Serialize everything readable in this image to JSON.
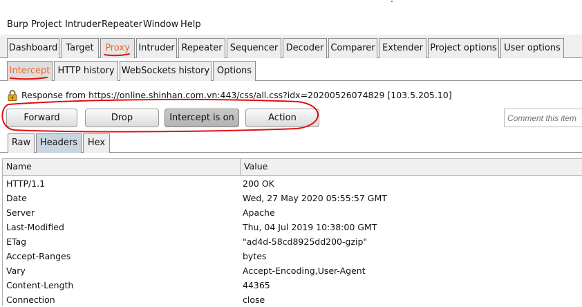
{
  "menu": [
    "Burp",
    "Project",
    "Intruder",
    "Repeater",
    "Window",
    "Help"
  ],
  "main_tabs": [
    "Dashboard",
    "Target",
    "Proxy",
    "Intruder",
    "Repeater",
    "Sequencer",
    "Decoder",
    "Comparer",
    "Extender",
    "Project options",
    "User options"
  ],
  "active_main_tab": "Proxy",
  "proxy_tabs": [
    "Intercept",
    "HTTP history",
    "WebSockets history",
    "Options"
  ],
  "active_proxy_tab": "Intercept",
  "intercept": {
    "response_info": "Response from https://online.shinhan.com.vn:443/css/all.css?idx=20200526074829  [103.5.205.10]",
    "buttons": {
      "forward": "Forward",
      "drop": "Drop",
      "intercept_toggle": "Intercept is on",
      "action": "Action"
    },
    "comment_placeholder": "Comment this item"
  },
  "view_tabs": [
    "Raw",
    "Headers",
    "Hex"
  ],
  "active_view_tab": "Headers",
  "headers_table": {
    "columns": [
      "Name",
      "Value"
    ],
    "rows": [
      {
        "name": "HTTP/1.1",
        "value": "200 OK"
      },
      {
        "name": "Date",
        "value": "Wed, 27 May 2020 05:55:57 GMT"
      },
      {
        "name": "Server",
        "value": "Apache"
      },
      {
        "name": "Last-Modified",
        "value": "Thu, 04 Jul 2019 10:38:00 GMT"
      },
      {
        "name": "ETag",
        "value": "\"ad4d-58cd8925dd200-gzip\""
      },
      {
        "name": "Accept-Ranges",
        "value": "bytes"
      },
      {
        "name": "Vary",
        "value": "Accept-Encoding,User-Agent"
      },
      {
        "name": "Content-Length",
        "value": "44365"
      },
      {
        "name": "Connection",
        "value": "close"
      }
    ]
  },
  "colors": {
    "active_tab_text": "#e8652d",
    "annotation": "#e01010",
    "headers_tab_bg": "#c9d5e1"
  }
}
